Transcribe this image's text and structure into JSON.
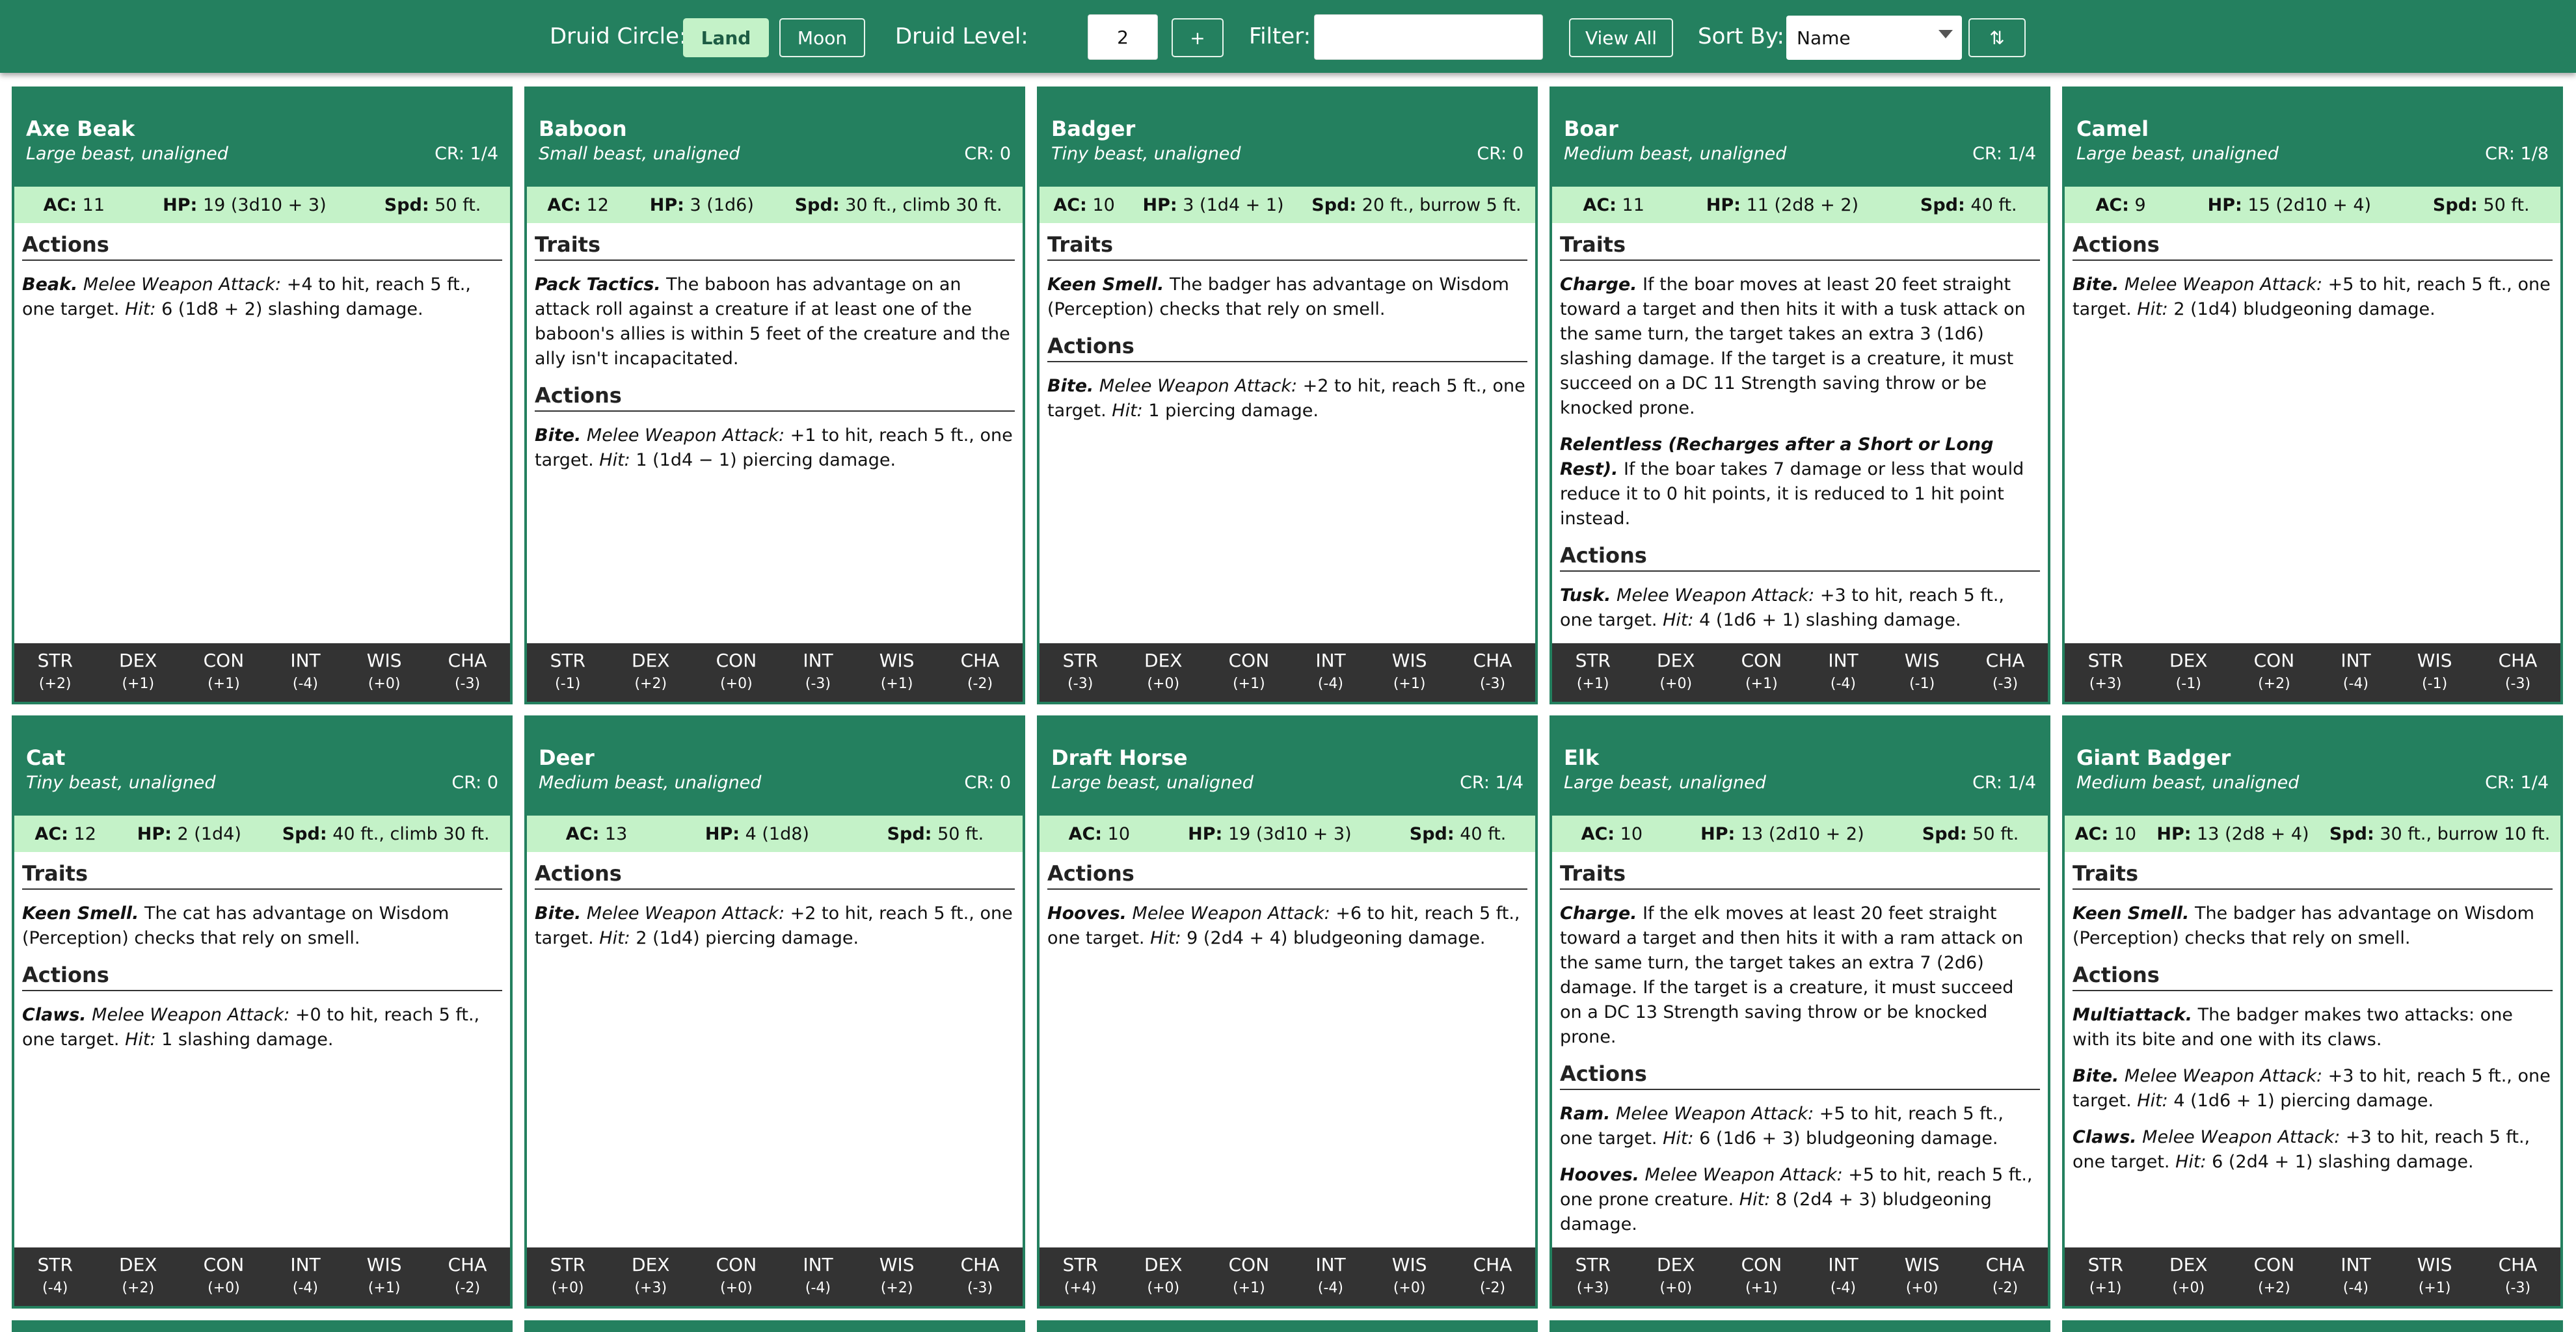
{
  "topbar": {
    "circle_label": "Druid Circle:",
    "land_label": "Land",
    "moon_label": "Moon",
    "level_label": "Druid Level:",
    "level_value": "2",
    "plus_label": "+",
    "filter_label": "Filter:",
    "filter_value": "",
    "view_all_label": "View All",
    "sort_label": "Sort By:",
    "sort_value": "Name",
    "sort_dir_label": "⇅"
  },
  "ability_names": [
    "STR",
    "DEX",
    "CON",
    "INT",
    "WIS",
    "CHA"
  ],
  "cards": [
    {
      "name": "Axe Beak",
      "type": "Large beast, unaligned",
      "cr": "CR: 1/4",
      "ac": "11",
      "hp": "19 (3d10 + 3)",
      "spd": "50 ft.",
      "sections": [
        {
          "title": "Actions",
          "entries": [
            {
              "name": "Beak.",
              "atk": "Melee Weapon Attack:",
              "text": " +4 to hit, reach 5 ft., one target. ",
              "hit": "Hit:",
              "tail": " 6 (1d8 + 2) slashing damage."
            }
          ]
        }
      ],
      "abilities": [
        "(+2)",
        "(+1)",
        "(+1)",
        "(-4)",
        "(+0)",
        "(-3)"
      ]
    },
    {
      "name": "Baboon",
      "type": "Small beast, unaligned",
      "cr": "CR: 0",
      "ac": "12",
      "hp": "3 (1d6)",
      "spd": "30 ft., climb 30 ft.",
      "sections": [
        {
          "title": "Traits",
          "entries": [
            {
              "name": "Pack Tactics.",
              "text": " The baboon has advantage on an attack roll against a creature if at least one of the baboon's allies is within 5 feet of the creature and the ally isn't incapacitated."
            }
          ]
        },
        {
          "title": "Actions",
          "entries": [
            {
              "name": "Bite.",
              "atk": "Melee Weapon Attack:",
              "text": " +1 to hit, reach 5 ft., one target. ",
              "hit": "Hit:",
              "tail": " 1 (1d4 − 1) piercing damage."
            }
          ]
        }
      ],
      "abilities": [
        "(-1)",
        "(+2)",
        "(+0)",
        "(-3)",
        "(+1)",
        "(-2)"
      ]
    },
    {
      "name": "Badger",
      "type": "Tiny beast, unaligned",
      "cr": "CR: 0",
      "ac": "10",
      "hp": "3 (1d4 + 1)",
      "spd": "20 ft., burrow 5 ft.",
      "sections": [
        {
          "title": "Traits",
          "entries": [
            {
              "name": "Keen Smell.",
              "text": " The badger has advantage on Wisdom (Perception) checks that rely on smell."
            }
          ]
        },
        {
          "title": "Actions",
          "entries": [
            {
              "name": "Bite.",
              "atk": "Melee Weapon Attack:",
              "text": " +2 to hit, reach 5 ft., one target. ",
              "hit": "Hit:",
              "tail": " 1 piercing damage."
            }
          ]
        }
      ],
      "abilities": [
        "(-3)",
        "(+0)",
        "(+1)",
        "(-4)",
        "(+1)",
        "(-3)"
      ]
    },
    {
      "name": "Boar",
      "type": "Medium beast, unaligned",
      "cr": "CR: 1/4",
      "ac": "11",
      "hp": "11 (2d8 + 2)",
      "spd": "40 ft.",
      "sections": [
        {
          "title": "Traits",
          "entries": [
            {
              "name": "Charge.",
              "text": " If the boar moves at least 20 feet straight toward a target and then hits it with a tusk attack on the same turn, the target takes an extra 3 (1d6) slashing damage. If the target is a creature, it must succeed on a DC 11 Strength saving throw or be knocked prone."
            },
            {
              "name": "Relentless (Recharges after a Short or Long Rest).",
              "text": " If the boar takes 7 damage or less that would reduce it to 0 hit points, it is reduced to 1 hit point instead."
            }
          ]
        },
        {
          "title": "Actions",
          "entries": [
            {
              "name": "Tusk.",
              "atk": "Melee Weapon Attack:",
              "text": " +3 to hit, reach 5 ft., one target. ",
              "hit": "Hit:",
              "tail": " 4 (1d6 + 1) slashing damage."
            }
          ]
        }
      ],
      "abilities": [
        "(+1)",
        "(+0)",
        "(+1)",
        "(-4)",
        "(-1)",
        "(-3)"
      ]
    },
    {
      "name": "Camel",
      "type": "Large beast, unaligned",
      "cr": "CR: 1/8",
      "ac": "9",
      "hp": "15 (2d10 + 4)",
      "spd": "50 ft.",
      "sections": [
        {
          "title": "Actions",
          "entries": [
            {
              "name": "Bite.",
              "atk": "Melee Weapon Attack:",
              "text": " +5 to hit, reach 5 ft., one target. ",
              "hit": "Hit:",
              "tail": " 2 (1d4) bludgeoning damage."
            }
          ]
        }
      ],
      "abilities": [
        "(+3)",
        "(-1)",
        "(+2)",
        "(-4)",
        "(-1)",
        "(-3)"
      ]
    },
    {
      "name": "Cat",
      "type": "Tiny beast, unaligned",
      "cr": "CR: 0",
      "ac": "12",
      "hp": "2 (1d4)",
      "spd": "40 ft., climb 30 ft.",
      "sections": [
        {
          "title": "Traits",
          "entries": [
            {
              "name": "Keen Smell.",
              "text": " The cat has advantage on Wisdom (Perception) checks that rely on smell."
            }
          ]
        },
        {
          "title": "Actions",
          "entries": [
            {
              "name": "Claws.",
              "atk": "Melee Weapon Attack:",
              "text": " +0 to hit, reach 5 ft., one target. ",
              "hit": "Hit:",
              "tail": " 1 slashing damage."
            }
          ]
        }
      ],
      "abilities": [
        "(-4)",
        "(+2)",
        "(+0)",
        "(-4)",
        "(+1)",
        "(-2)"
      ]
    },
    {
      "name": "Deer",
      "type": "Medium beast, unaligned",
      "cr": "CR: 0",
      "ac": "13",
      "hp": "4 (1d8)",
      "spd": "50 ft.",
      "sections": [
        {
          "title": "Actions",
          "entries": [
            {
              "name": "Bite.",
              "atk": "Melee Weapon Attack:",
              "text": " +2 to hit, reach 5 ft., one target. ",
              "hit": "Hit:",
              "tail": " 2 (1d4) piercing damage."
            }
          ]
        }
      ],
      "abilities": [
        "(+0)",
        "(+3)",
        "(+0)",
        "(-4)",
        "(+2)",
        "(-3)"
      ]
    },
    {
      "name": "Draft Horse",
      "type": "Large beast, unaligned",
      "cr": "CR: 1/4",
      "ac": "10",
      "hp": "19 (3d10 + 3)",
      "spd": "40 ft.",
      "sections": [
        {
          "title": "Actions",
          "entries": [
            {
              "name": "Hooves.",
              "atk": "Melee Weapon Attack:",
              "text": " +6 to hit, reach 5 ft., one target. ",
              "hit": "Hit:",
              "tail": " 9 (2d4 + 4) bludgeoning damage."
            }
          ]
        }
      ],
      "abilities": [
        "(+4)",
        "(+0)",
        "(+1)",
        "(-4)",
        "(+0)",
        "(-2)"
      ]
    },
    {
      "name": "Elk",
      "type": "Large beast, unaligned",
      "cr": "CR: 1/4",
      "ac": "10",
      "hp": "13 (2d10 + 2)",
      "spd": "50 ft.",
      "sections": [
        {
          "title": "Traits",
          "entries": [
            {
              "name": "Charge.",
              "text": " If the elk moves at least 20 feet straight toward a target and then hits it with a ram attack on the same turn, the target takes an extra 7 (2d6) damage. If the target is a creature, it must succeed on a DC 13 Strength saving throw or be knocked prone."
            }
          ]
        },
        {
          "title": "Actions",
          "entries": [
            {
              "name": "Ram.",
              "atk": "Melee Weapon Attack:",
              "text": " +5 to hit, reach 5 ft., one target. ",
              "hit": "Hit:",
              "tail": " 6 (1d6 + 3) bludgeoning damage."
            },
            {
              "name": "Hooves.",
              "atk": "Melee Weapon Attack:",
              "text": " +5 to hit, reach 5 ft., one prone creature. ",
              "hit": "Hit:",
              "tail": " 8 (2d4 + 3) bludgeoning damage."
            }
          ]
        }
      ],
      "abilities": [
        "(+3)",
        "(+0)",
        "(+1)",
        "(-4)",
        "(+0)",
        "(-2)"
      ]
    },
    {
      "name": "Giant Badger",
      "type": "Medium beast, unaligned",
      "cr": "CR: 1/4",
      "ac": "10",
      "hp": "13 (2d8 + 4)",
      "spd": "30 ft., burrow 10 ft.",
      "sections": [
        {
          "title": "Traits",
          "entries": [
            {
              "name": "Keen Smell.",
              "text": " The badger has advantage on Wisdom (Perception) checks that rely on smell."
            }
          ]
        },
        {
          "title": "Actions",
          "entries": [
            {
              "name": "Multiattack.",
              "text": " The badger makes two attacks: one with its bite and one with its claws."
            },
            {
              "name": "Bite.",
              "atk": "Melee Weapon Attack:",
              "text": " +3 to hit, reach 5 ft., one target. ",
              "hit": "Hit:",
              "tail": " 4 (1d6 + 1) piercing damage."
            },
            {
              "name": "Claws.",
              "atk": "Melee Weapon Attack:",
              "text": " +3 to hit, reach 5 ft., one target. ",
              "hit": "Hit:",
              "tail": " 6 (2d4 + 1) slashing damage."
            }
          ]
        }
      ],
      "abilities": [
        "(+1)",
        "(+0)",
        "(+2)",
        "(-4)",
        "(+1)",
        "(-3)"
      ]
    }
  ]
}
